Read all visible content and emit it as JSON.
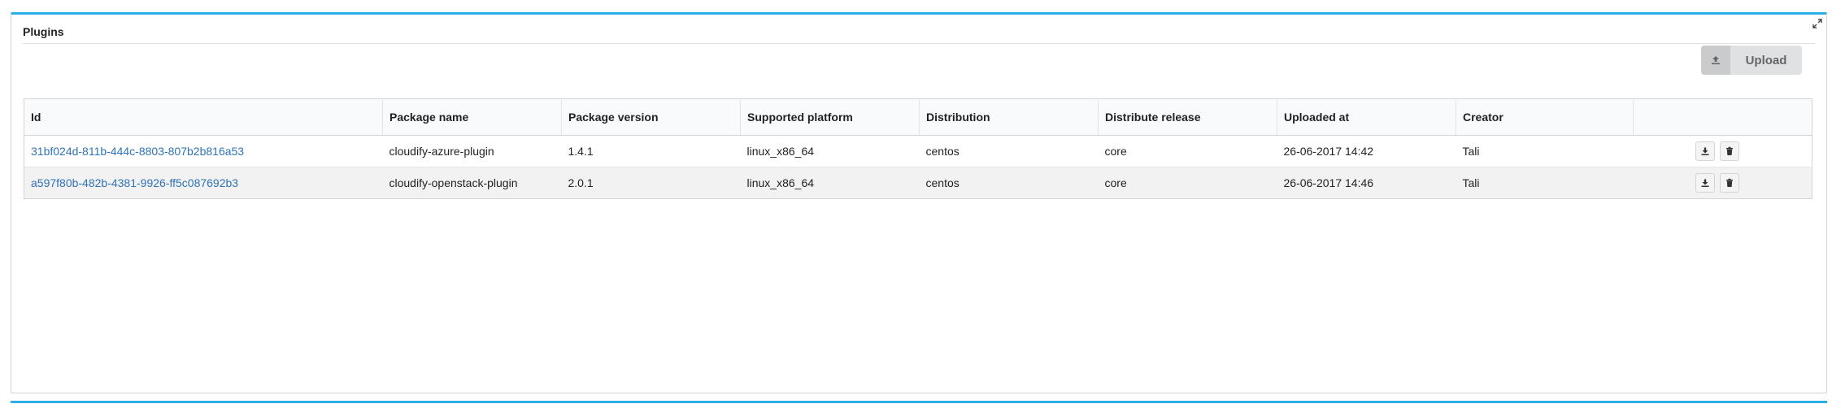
{
  "widget": {
    "title": "Plugins",
    "accent_color": "#2bafe6",
    "maximize_icon": "expand-icon"
  },
  "toolbar": {
    "upload_label": "Upload",
    "upload_icon": "upload-icon"
  },
  "table": {
    "columns": [
      "Id",
      "Package name",
      "Package version",
      "Supported platform",
      "Distribution",
      "Distribute release",
      "Uploaded at",
      "Creator",
      ""
    ],
    "rows": [
      {
        "id": "31bf024d-811b-444c-8803-807b2b816a53",
        "package_name": "cloudify-azure-plugin",
        "package_version": "1.4.1",
        "supported_platform": "linux_x86_64",
        "distribution": "centos",
        "distribute_release": "core",
        "uploaded_at": "26-06-2017 14:42",
        "creator": "Tali"
      },
      {
        "id": "a597f80b-482b-4381-9926-ff5c087692b3",
        "package_name": "cloudify-openstack-plugin",
        "package_version": "2.0.1",
        "supported_platform": "linux_x86_64",
        "distribution": "centos",
        "distribute_release": "core",
        "uploaded_at": "26-06-2017 14:46",
        "creator": "Tali"
      }
    ],
    "row_actions": [
      "download-icon",
      "trash-icon"
    ],
    "link_color": "#2f73b7"
  }
}
